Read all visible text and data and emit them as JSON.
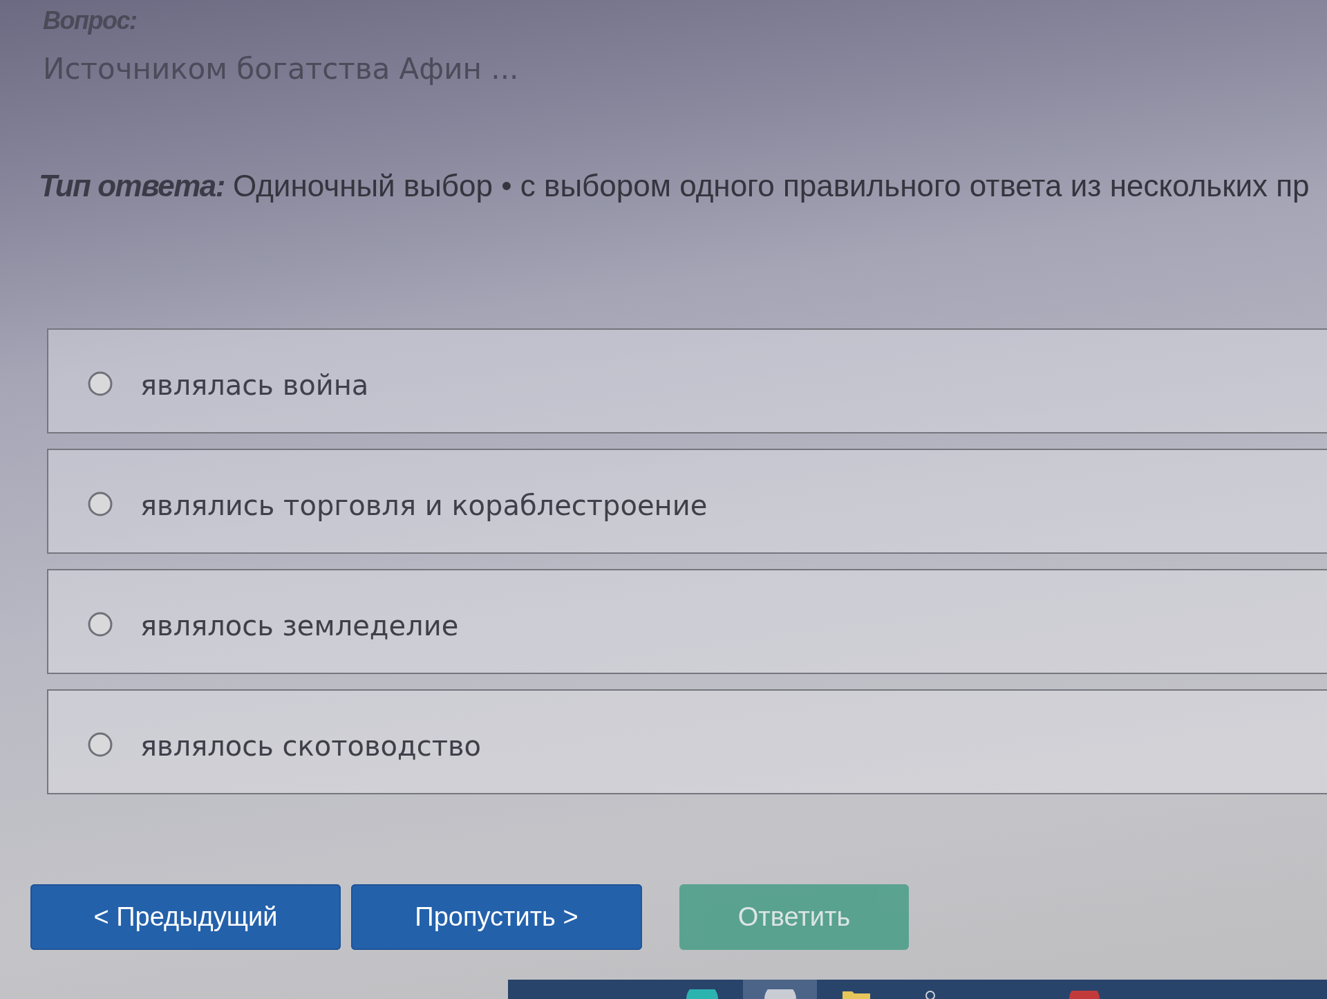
{
  "question": {
    "label": "Вопрос:",
    "text": "Источником богатства Афин ..."
  },
  "answer_type": {
    "label": "Тип ответа:",
    "text": "Одиночный выбор • с выбором одного правильного ответа из нескольких пр"
  },
  "options": [
    {
      "text": "являлась война",
      "selected": false
    },
    {
      "text": "являлись торговля и кораблестроение",
      "selected": false
    },
    {
      "text": "являлось земледелие",
      "selected": false
    },
    {
      "text": "являлось скотоводство",
      "selected": false
    }
  ],
  "buttons": [
    {
      "label": "< Предыдущий",
      "kind": "nav",
      "disabled": false
    },
    {
      "label": "Пропустить >",
      "kind": "nav",
      "disabled": false
    },
    {
      "label": "Ответить",
      "kind": "submit",
      "disabled": true
    }
  ]
}
